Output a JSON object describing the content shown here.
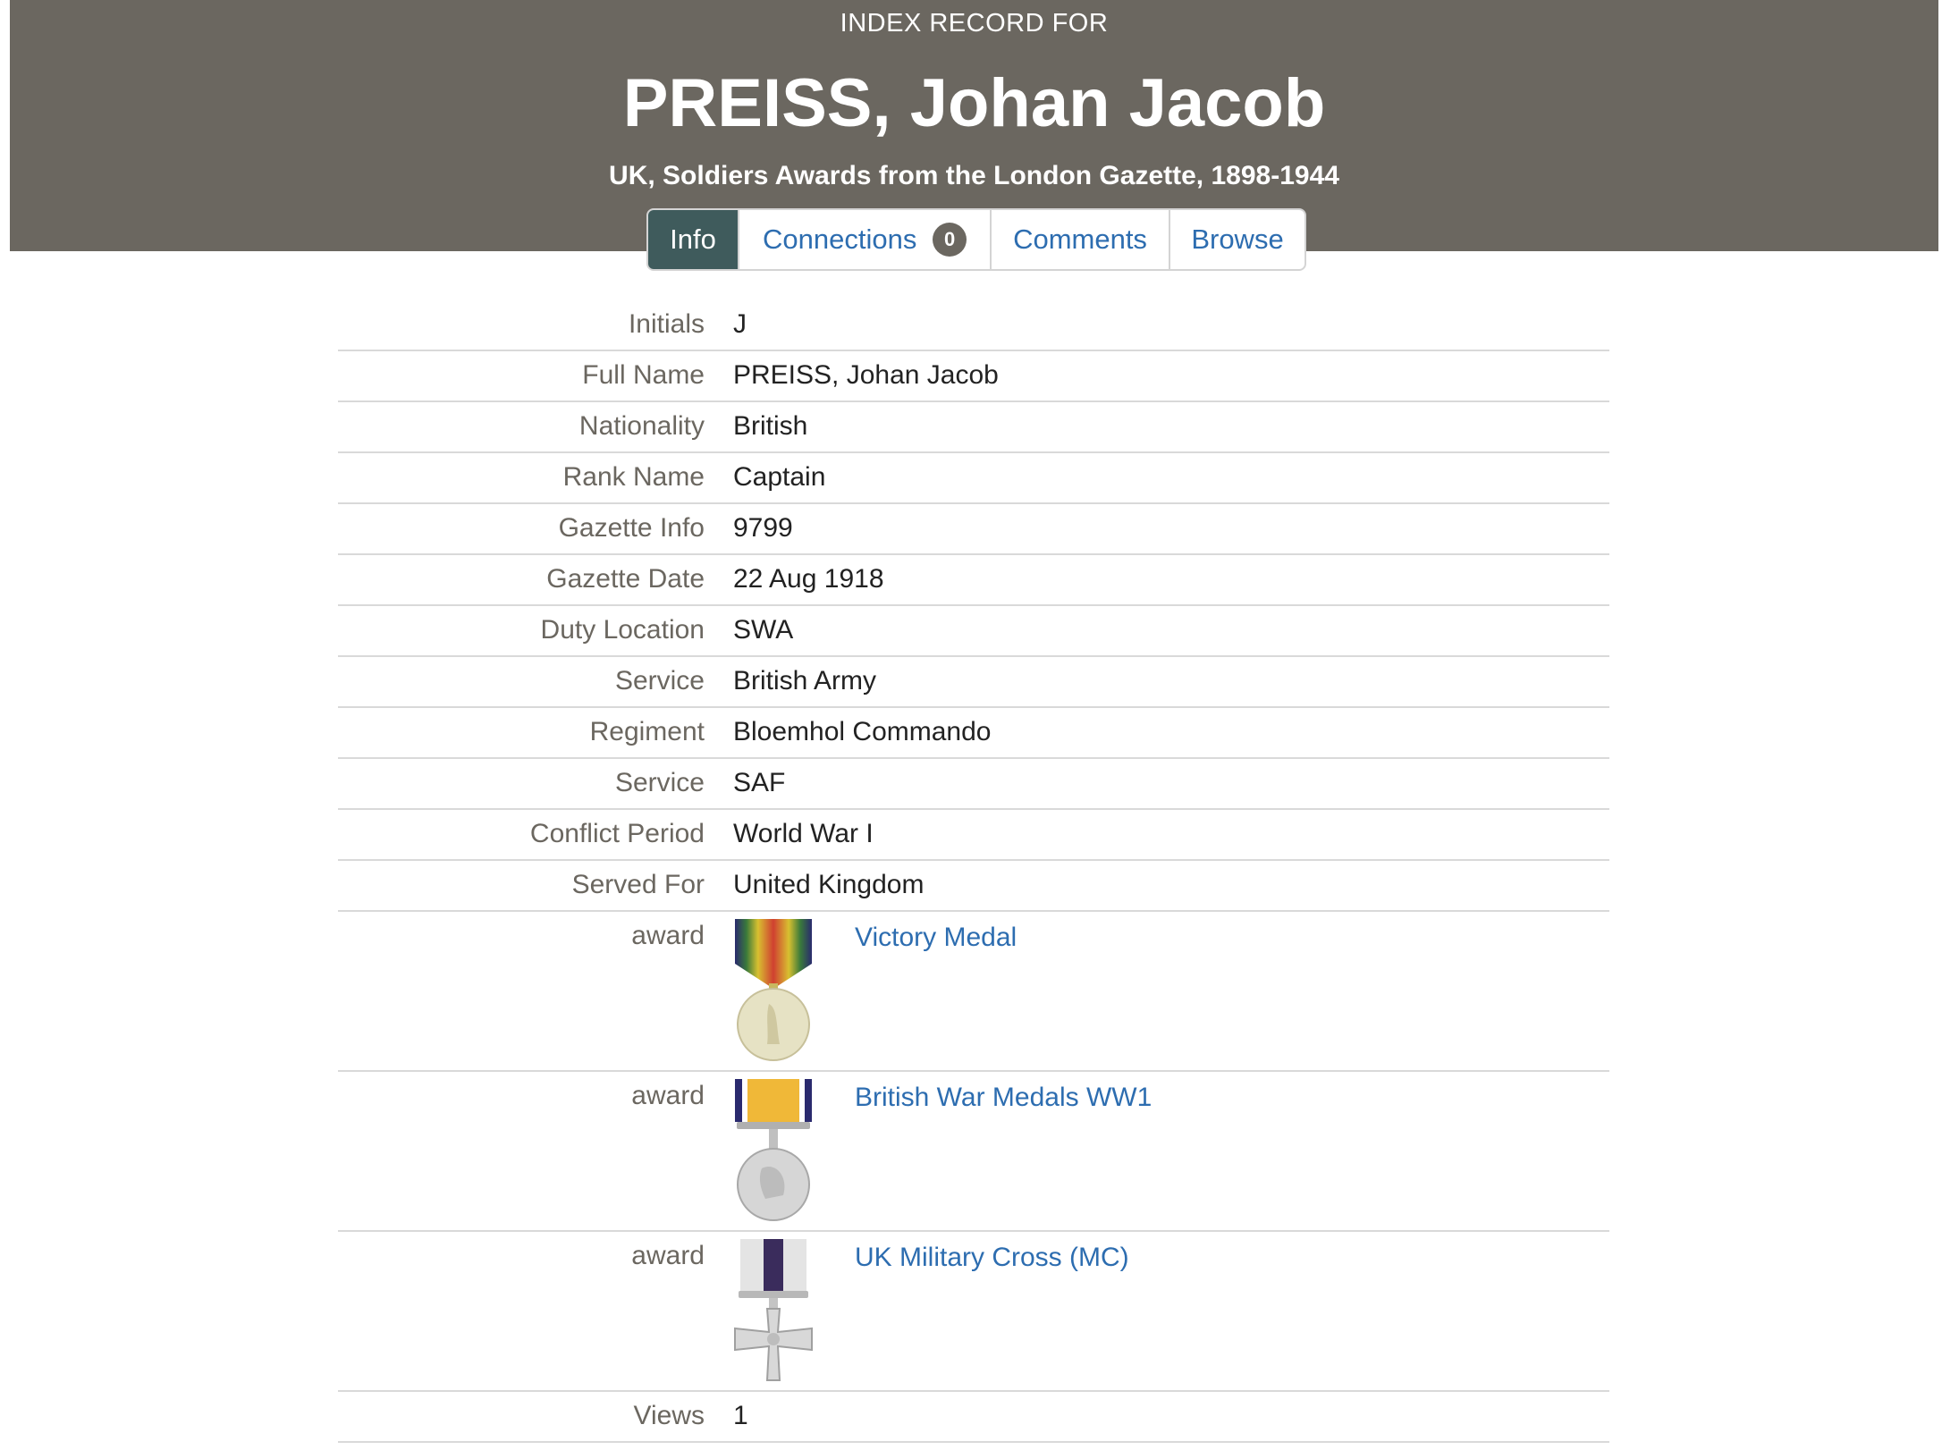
{
  "header": {
    "eyebrow": "INDEX RECORD FOR",
    "title": "PREISS, Johan Jacob",
    "subtitle": "UK, Soldiers Awards from the London Gazette, 1898-1944"
  },
  "tabs": [
    {
      "label": "Info",
      "active": true
    },
    {
      "label": "Connections",
      "badge": "0"
    },
    {
      "label": "Comments"
    },
    {
      "label": "Browse"
    }
  ],
  "fields": [
    {
      "label": "Initials",
      "value": "J"
    },
    {
      "label": "Full Name",
      "value": "PREISS, Johan Jacob"
    },
    {
      "label": "Nationality",
      "value": "British"
    },
    {
      "label": "Rank Name",
      "value": "Captain"
    },
    {
      "label": "Gazette Info",
      "value": "9799"
    },
    {
      "label": "Gazette Date",
      "value": "22 Aug 1918"
    },
    {
      "label": "Duty Location",
      "value": "SWA"
    },
    {
      "label": "Service",
      "value": "British Army"
    },
    {
      "label": "Regiment",
      "value": "Bloemhol Commando"
    },
    {
      "label": "Service",
      "value": "SAF"
    },
    {
      "label": "Conflict Period",
      "value": "World War I"
    },
    {
      "label": "Served For",
      "value": "United Kingdom"
    }
  ],
  "awards": [
    {
      "label": "award",
      "name": "Victory Medal",
      "icon": "victory-medal-icon"
    },
    {
      "label": "award",
      "name": "British War Medals WW1",
      "icon": "british-war-medal-icon"
    },
    {
      "label": "award",
      "name": "UK Military Cross (MC)",
      "icon": "military-cross-icon"
    }
  ],
  "views": {
    "label": "Views",
    "value": "1"
  }
}
